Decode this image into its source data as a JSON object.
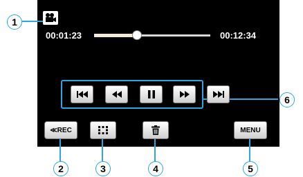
{
  "player": {
    "elapsed_time": "00:01:23",
    "total_time": "00:12:34",
    "progress_fraction": 0.37
  },
  "controls": {
    "rec_label": "≪REC",
    "menu_label": "MENU",
    "icons": [
      "skip-back-icon",
      "rewind-icon",
      "pause-icon",
      "fast-forward-icon",
      "skip-forward-icon",
      "index-icon",
      "trash-icon",
      "video-mode-icon"
    ]
  },
  "callouts": [
    "1",
    "2",
    "3",
    "4",
    "5",
    "6"
  ],
  "colors": {
    "screen": "#000000",
    "accent": "#2aa6e0",
    "button": "#e0e0e0"
  }
}
